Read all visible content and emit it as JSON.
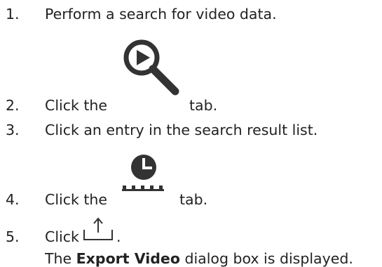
{
  "steps": [
    {
      "number": "1.",
      "text": "Perform a search for video data."
    },
    {
      "number": "2.",
      "before": "Click the",
      "icon": "search-playback-icon",
      "after": "tab."
    },
    {
      "number": "3.",
      "text": "Click an entry in the search result list."
    },
    {
      "number": "4.",
      "before": "Click the",
      "icon": "clock-timeline-icon",
      "after": "tab."
    },
    {
      "number": "5.",
      "before": "Click",
      "icon": "export-icon",
      "after": "."
    }
  ],
  "result": {
    "before": "The",
    "bold": "Export Video",
    "after": "dialog box is displayed."
  },
  "colors": {
    "text": "#222222",
    "icon": "#333333"
  }
}
